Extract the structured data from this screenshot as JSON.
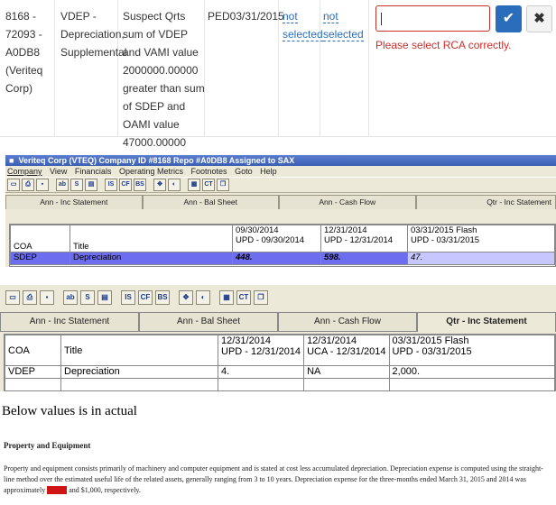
{
  "rca_row": {
    "id": "8168 - 72093 - A0DB8 (Veriteq Corp)",
    "description": "VDEP - Depreciation, Supplemental",
    "check": "Suspect Qrts sum of VDEP and VAMI value 2000000.00000 greater than sum of SDEP and OAMI value 47000.00000",
    "period": "PED03/31/2015",
    "not_selected_1": "not selected",
    "not_selected_2": "not selected",
    "rca_input_value": "",
    "ok_icon": "✔",
    "cancel_icon": "✖",
    "error": "Please select RCA correctly."
  },
  "app1": {
    "title": "Veriteq Corp  (VTEQ)  Company ID #8168  Repo #A0DB8  Assigned to SAX",
    "menu": [
      "Company",
      "View",
      "Financials",
      "Operating Metrics",
      "Footnotes",
      "Goto",
      "Help"
    ],
    "toolbar_icons": [
      "open-icon",
      "print-icon",
      "save-icon",
      "abc-icon",
      "s-icon",
      "doc-icon",
      "is-icon",
      "cf-icon",
      "bs-icon",
      "nav-icon",
      "nav2-icon",
      "chart-icon",
      "ct-icon",
      "window-icon"
    ],
    "tabs": [
      "Ann - Inc Statement",
      "Ann - Bal Sheet",
      "Ann - Cash Flow",
      "Qtr - Inc Statement"
    ],
    "headers": {
      "coa": "COA",
      "title": "Title",
      "c1a": "09/30/2014",
      "c1b": "UPD - 09/30/2014",
      "c2a": "12/31/2014",
      "c2b": "UPD - 12/31/2014",
      "c3a": "03/31/2015 Flash",
      "c3b": "UPD - 03/31/2015"
    },
    "row": {
      "coa": "SDEP",
      "title": "Depreciation",
      "v1": "448.",
      "v2": "598.",
      "v3": "47."
    }
  },
  "app2": {
    "toolbar_icons": [
      "open-icon",
      "print-icon",
      "save-icon",
      "abc-icon",
      "s-icon",
      "doc-icon",
      "is-icon",
      "cf-icon",
      "bs-icon",
      "nav-icon",
      "nav2-icon",
      "chart-icon",
      "ct-icon",
      "window-icon"
    ],
    "tabs": [
      "Ann - Inc Statement",
      "Ann - Bal Sheet",
      "Ann - Cash Flow",
      "Qtr - Inc Statement"
    ],
    "headers": {
      "coa": "COA",
      "title": "Title",
      "c1a": "12/31/2014",
      "c1b": "UPD - 12/31/2014",
      "c2a": "12/31/2014",
      "c2b": "UCA - 12/31/2014",
      "c3a": "03/31/2015 Flash",
      "c3b": "UPD - 03/31/2015"
    },
    "row": {
      "coa": "VDEP",
      "title": "Depreciation",
      "v1": "4.",
      "v2": "NA",
      "v3": "2,000."
    }
  },
  "note": "Below values is in actual",
  "doc": {
    "heading": "Property and Equipment",
    "para_a": "Property and equipment consists primarily of machinery and computer equipment and is stated at cost less accumulated depreciation. Depreciation expense is computed using the straight-line method over the estimated useful life of the related assets, generally ranging from 3 to 10 years. Depreciation expense for the three-months ended March 31, 2015 and 2014 was approximately ",
    "highlight": "$2,000",
    "para_b": " and $1,000, respectively.",
    "highlight_color": "#d01515"
  }
}
